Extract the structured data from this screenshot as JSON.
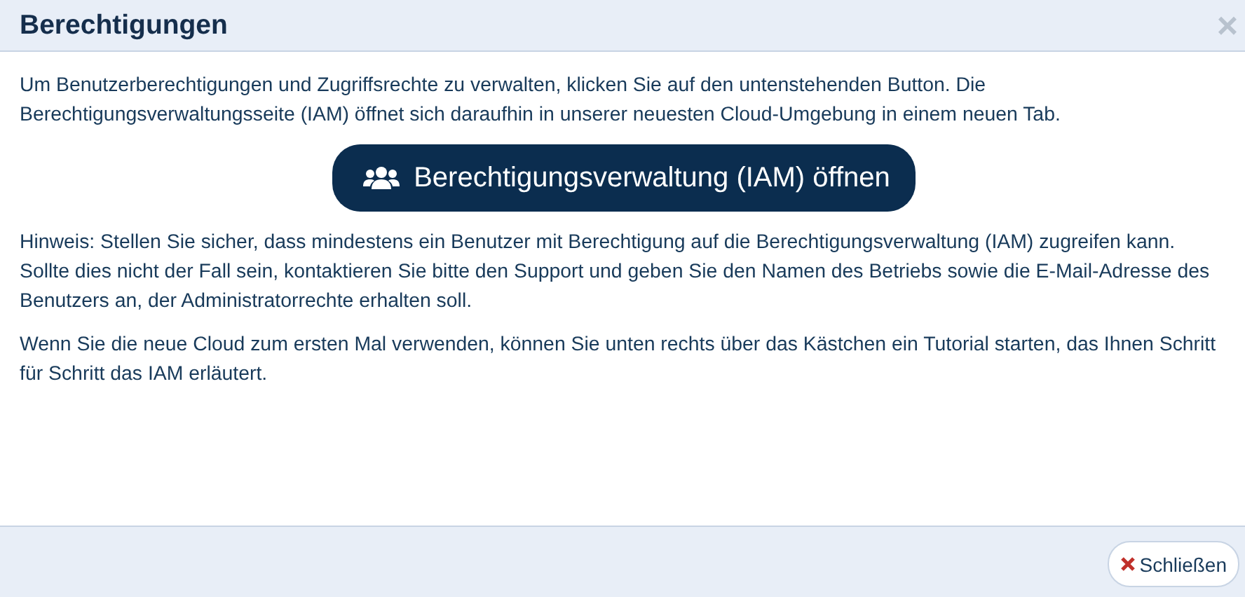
{
  "dialog": {
    "title": "Berechtigungen",
    "close_icon": "×"
  },
  "intro": "Um Benutzerberechtigungen und Zugriffsrechte zu verwalten, klicken Sie auf den untenstehenden Button. Die Berechtigungsverwaltungsseite (IAM) öffnet sich daraufhin in unserer neuesten Cloud-Umgebung in einem neuen Tab.",
  "action_button": "Berechtigungsverwaltung (IAM) öffnen",
  "paragraphs": [
    "Hinweis: Stellen Sie sicher, dass mindestens ein Benutzer mit Berechtigung auf die Berechtigungsverwaltung (IAM) zugreifen kann. Sollte dies nicht der Fall sein, kontaktieren Sie bitte den Support und geben Sie den Namen des Betriebs sowie die E-Mail-Adresse des Benutzers an, der Administratorrechte erhalten soll.",
    "Wenn Sie die neue Cloud zum ersten Mal verwenden, können Sie unten rechts über das Kästchen ein Tutorial starten, das Ihnen Schritt für Schritt das IAM erläutert."
  ],
  "footer": {
    "close_button": "Schließen"
  }
}
